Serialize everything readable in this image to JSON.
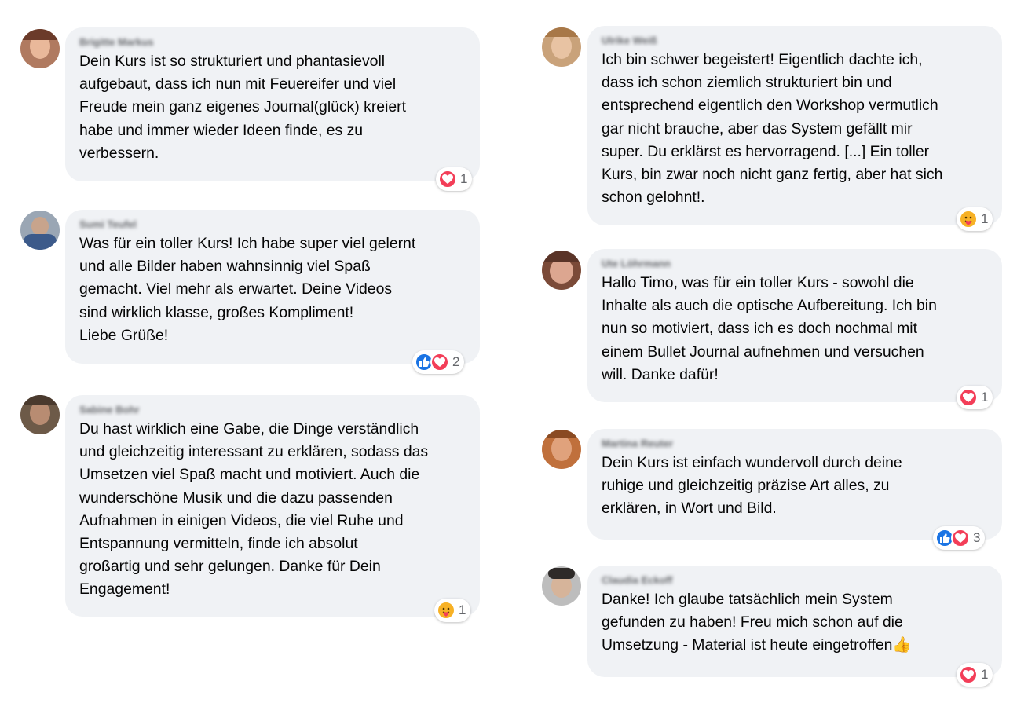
{
  "comments": [
    {
      "author": "Brigitte Markus",
      "text": "Dein Kurs ist so strukturiert und phantasievoll\naufgebaut, dass ich nun mit Feuereifer und viel\nFreude mein ganz eigenes Journal(glück) kreiert\nhabe und immer wieder Ideen finde, es zu\nverbessern.",
      "reactions": [
        "heart"
      ],
      "count": "1"
    },
    {
      "author": "Sumi Teufel",
      "text": "Was für ein toller Kurs! Ich habe super viel gelernt\nund alle Bilder haben wahnsinnig viel Spaß\ngemacht. Viel mehr als erwartet. Deine Videos\nsind wirklich klasse, großes Kompliment!\nLiebe Grüße!",
      "reactions": [
        "like",
        "heart"
      ],
      "count": "2"
    },
    {
      "author": "Sabine Bohr",
      "text": "Du hast wirklich eine Gabe, die Dinge verständlich\nund gleichzeitig interessant zu erklären, sodass das\nUmsetzen viel Spaß macht und motiviert. Auch die\nwunderschöne Musik und die dazu passenden\nAufnahmen in einigen Videos, die viel Ruhe und\nEntspannung vermitteln, finde ich absolut\ngroßartig und sehr gelungen. Danke für Dein\nEngagement!",
      "reactions": [
        "care"
      ],
      "count": "1"
    },
    {
      "author": "Ulrike Weiß",
      "text": "Ich bin schwer begeistert! Eigentlich dachte ich,\ndass ich schon ziemlich strukturiert bin und\nentsprechend eigentlich den Workshop vermutlich\ngar nicht brauche, aber das System gefällt mir\nsuper. Du erklärst es hervorragend. [...] Ein toller\nKurs, bin zwar noch nicht ganz fertig, aber hat sich\nschon gelohnt!.",
      "reactions": [
        "care"
      ],
      "count": "1"
    },
    {
      "author": "Ute Löhrmann",
      "text": "Hallo Timo, was für ein toller Kurs - sowohl die\nInhalte als auch die optische Aufbereitung. Ich bin\nnun so motiviert, dass ich es doch nochmal mit\neinem Bullet Journal aufnehmen und versuchen\nwill. Danke dafür!",
      "reactions": [
        "heart"
      ],
      "count": "1"
    },
    {
      "author": "Martina Reuter",
      "text": "Dein Kurs ist einfach wundervoll durch deine\nruhige und gleichzeitig präzise Art alles, zu\nerklären, in Wort und Bild.",
      "reactions": [
        "like",
        "heart"
      ],
      "count": "3"
    },
    {
      "author": "Claudia Eckoff",
      "text": "Danke! Ich glaube tatsächlich mein System\ngefunden zu haben! Freu mich schon auf die\nUmsetzung - Material ist heute eingetroffen👍",
      "reactions": [
        "heart"
      ],
      "count": "1"
    }
  ],
  "colors": {
    "bubble": "#f0f2f5",
    "heart": "#f33e58",
    "like": "#1b74e4",
    "care": "#f7b125",
    "count_text": "#65676b"
  },
  "icons": {
    "heart": "heart-reaction-icon",
    "like": "like-reaction-icon",
    "care": "care-reaction-icon"
  }
}
